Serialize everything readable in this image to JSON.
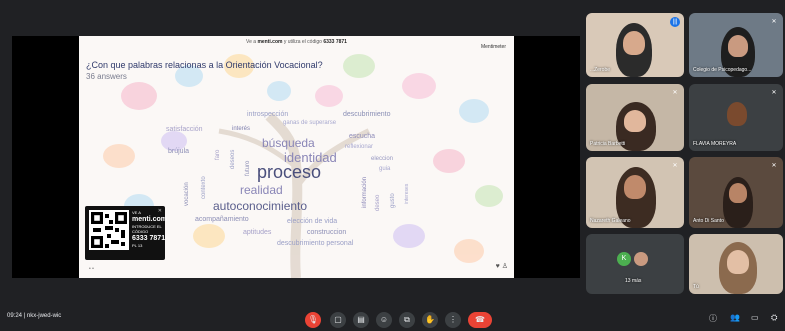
{
  "meeting": {
    "time": "09:24",
    "code": "nkx-jwed-wic"
  },
  "slide": {
    "header_pre": "Ve a",
    "header_site": "menti.com",
    "header_mid": "y utiliza el código",
    "header_code": "6333 7871",
    "brand": "Mentimeter",
    "question": "¿Con que palabras relacionas a la Orientación Vocacional?",
    "answers": "36 answers",
    "qr": {
      "line1": "VE A",
      "site": "menti.com",
      "line2": "INTRODUCE EL",
      "line3": "CÓDIGO",
      "code": "6333 7871",
      "footer": "PL 13"
    }
  },
  "wordcloud": {
    "words": [
      {
        "text": "proceso",
        "color": "#4a4f7c"
      },
      {
        "text": "identidad",
        "color": "#8a86b7"
      },
      {
        "text": "búsqueda",
        "color": "#8a86b7"
      },
      {
        "text": "realidad",
        "color": "#8a86b7"
      },
      {
        "text": "autoconocimiento",
        "color": "#5a5e8c"
      },
      {
        "text": "introspección",
        "color": "#9a9fc6"
      },
      {
        "text": "descubrimiento",
        "color": "#8a8fb5"
      },
      {
        "text": "ganas de superarse",
        "color": "#a8a9cf"
      },
      {
        "text": "satisfacción",
        "color": "#a7a2c9"
      },
      {
        "text": "interés",
        "color": "#7e7fae"
      },
      {
        "text": "escucha",
        "color": "#8f8db9"
      },
      {
        "text": "reflexionar",
        "color": "#a7a7cf"
      },
      {
        "text": "brújula",
        "color": "#8d8fb6"
      },
      {
        "text": "eleccion",
        "color": "#9798c1"
      },
      {
        "text": "guia",
        "color": "#a7a7cf"
      },
      {
        "text": "acompañamiento",
        "color": "#8d8fb6"
      },
      {
        "text": "elección de vida",
        "color": "#9a9fc6"
      },
      {
        "text": "aptitudes",
        "color": "#a7a2c9"
      },
      {
        "text": "construccion",
        "color": "#8d8fb6"
      },
      {
        "text": "descubrimiento personal",
        "color": "#9a9fc6"
      }
    ],
    "vertical_words": [
      {
        "text": "faro",
        "color": "#a7a2c9"
      },
      {
        "text": "deseos",
        "color": "#9a9fc6"
      },
      {
        "text": "futuro",
        "color": "#8d8fb6"
      },
      {
        "text": "contexto",
        "color": "#9a9fc6"
      },
      {
        "text": "vocación",
        "color": "#8d8fb6"
      },
      {
        "text": "información",
        "color": "#8a86b7"
      },
      {
        "text": "deseo",
        "color": "#a7a2c9"
      },
      {
        "text": "gusto",
        "color": "#9a9fc6"
      },
      {
        "text": "intereses",
        "color": "#a7a7cf"
      }
    ]
  },
  "participants": [
    {
      "name": "...Zerobe"
    },
    {
      "name": "Colegio de Psicopedago..."
    },
    {
      "name": "Patricia Barbetti"
    },
    {
      "name": "FLAVIA MOREYRA"
    },
    {
      "name": "Nazareth Galeano"
    },
    {
      "name": "Anto Di Santo"
    },
    {
      "name": "13 más",
      "avatar_letter": "K"
    },
    {
      "name": "Tú"
    }
  ],
  "colors": {
    "background": "#202124",
    "tile": "#3c4043",
    "end_call": "#ea4335",
    "mic_off": "#ea4335"
  }
}
